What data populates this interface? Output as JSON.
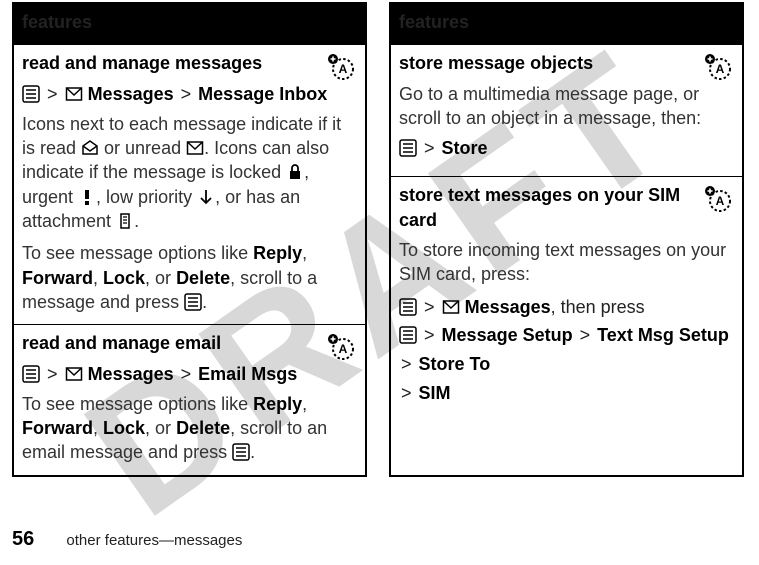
{
  "watermark": "DRAFT",
  "left": {
    "header": "features",
    "sections": [
      {
        "title": "read and manage messages",
        "nav_messages": "Messages",
        "nav_inbox": "Message Inbox",
        "para1_a": "Icons next to each message indicate if it is read ",
        "para1_b": " or unread ",
        "para1_c": ". Icons can also indicate if the message is locked ",
        "para1_d": ", urgent ",
        "para1_e": ", low priority ",
        "para1_f": ", or has an attachment ",
        "para1_g": ".",
        "para2_a": "To see message options like ",
        "para2_reply": "Reply",
        "para2_b": ", ",
        "para2_forward": "Forward",
        "para2_c": ", ",
        "para2_lock": "Lock",
        "para2_d": ", or ",
        "para2_delete": "Delete",
        "para2_e": ", scroll to a message and press ",
        "para2_f": "."
      },
      {
        "title": "read and manage email",
        "nav_messages": "Messages",
        "nav_email": "Email Msgs",
        "para_a": "To see message options like ",
        "para_reply": "Reply",
        "para_b": ", ",
        "para_forward": "Forward",
        "para_c": ", ",
        "para_lock": "Lock",
        "para_d": ", or ",
        "para_delete": "Delete",
        "para_e": ", scroll to an email message and press ",
        "para_f": "."
      }
    ]
  },
  "right": {
    "header": "features",
    "sections": [
      {
        "title": "store message objects",
        "para": "Go to a multimedia message page, or scroll to an object in a message, then:",
        "nav_store": "Store"
      },
      {
        "title": "store text messages on your SIM card",
        "para": "To store incoming text messages on your SIM card, press:",
        "nav_messages": "Messages",
        "then_press": ", then press",
        "nav_msgsetup": "Message Setup",
        "nav_textsetup": "Text Msg Setup",
        "nav_storeto": "Store To",
        "nav_sim": "SIM"
      }
    ]
  },
  "footer": {
    "page": "56",
    "label": "other features—messages"
  }
}
